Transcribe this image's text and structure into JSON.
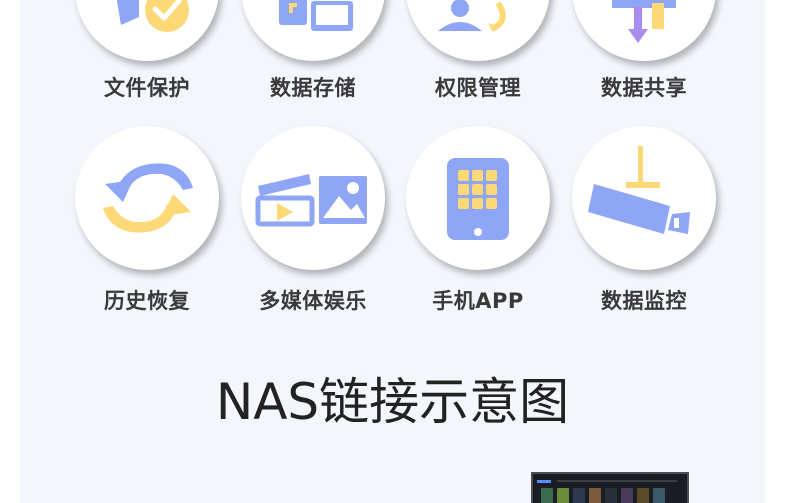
{
  "features": {
    "row1": [
      {
        "label": "文件保护",
        "icon": "file-protect-icon"
      },
      {
        "label": "数据存储",
        "icon": "data-storage-icon"
      },
      {
        "label": "权限管理",
        "icon": "permission-icon"
      },
      {
        "label": "数据共享",
        "icon": "data-share-icon"
      }
    ],
    "row2": [
      {
        "label": "历史恢复",
        "icon": "history-restore-icon"
      },
      {
        "label": "多媒体娱乐",
        "icon": "multimedia-icon"
      },
      {
        "label": "手机APP",
        "icon": "mobile-app-icon"
      },
      {
        "label": "数据监控",
        "icon": "surveillance-camera-icon"
      }
    ]
  },
  "section_title": "NAS链接示意图",
  "colors": {
    "panel_bg": "#f3f7fd",
    "icon_blue": "#8ea6f5",
    "icon_yellow": "#fcd876",
    "label_text": "#3a3a3a"
  }
}
